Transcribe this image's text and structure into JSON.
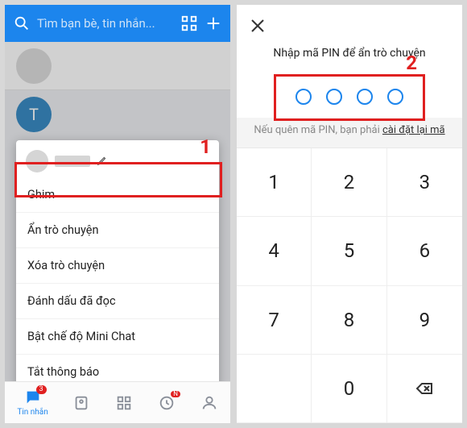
{
  "left": {
    "search_placeholder": "Tìm bạn bè, tin nhắn...",
    "avatar_letter": "T",
    "menu": {
      "items": [
        "Ghim",
        "Ẩn trò chuyện",
        "Xóa trò chuyện",
        "Đánh dấu đã đọc",
        "Bật chế độ Mini Chat",
        "Tắt thông báo"
      ]
    },
    "nav": {
      "msg_label": "Tin nhắn",
      "msg_badge": "3",
      "activity_badge": "N"
    },
    "callout": "1"
  },
  "right": {
    "title": "Nhập mã PIN để ẩn trò chuyện",
    "hint_prefix": "Nếu quên mã PIN, bạn phải ",
    "hint_link": "cài đặt lại mã",
    "callout": "2",
    "keys": [
      "1",
      "2",
      "3",
      "4",
      "5",
      "6",
      "7",
      "8",
      "9",
      "",
      "0",
      ""
    ]
  }
}
